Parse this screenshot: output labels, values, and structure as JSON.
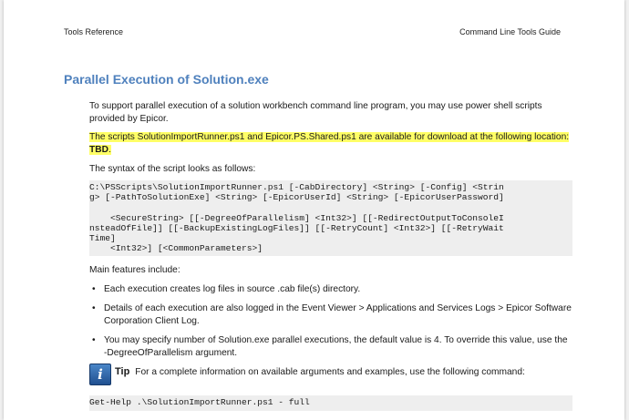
{
  "header": {
    "left": "Tools Reference",
    "right": "Command Line Tools Guide"
  },
  "section": {
    "title": "Parallel Execution of Solution.exe"
  },
  "content": {
    "intro": "To support parallel execution of a solution workbench command line program, you may use power shell scripts provided by Epicor.",
    "highlight_text": "The scripts SolutionImportRunner.ps1 and Epicor.PS.Shared.ps1 are available for download at the following location: ",
    "highlight_bold": "TBD",
    "highlight_end": ".",
    "syntax_intro": "The syntax of the script looks as follows:",
    "syntax_code": "C:\\PSScripts\\SolutionImportRunner.ps1 [-CabDirectory] <String> [-Config] <Strin\ng> [-PathToSolutionExe] <String> [-EpicorUserId] <String> [-EpicorUserPassword]\n\n    <SecureString> [[-DegreeOfParallelism] <Int32>] [[-RedirectOutputToConsoleI\nnsteadOfFile]] [[-BackupExistingLogFiles]] [[-RetryCount] <Int32>] [[-RetryWait\nTime]\n    <Int32>] [<CommonParameters>]",
    "features_intro": "Main features include:",
    "features": [
      "Each execution creates log files in source .cab file(s) directory.",
      "Details of each execution are also logged in the Event Viewer > Applications and Services Logs > Epicor Software Corporation Client Log.",
      "You may specify number of Solution.exe parallel executions, the default value is 4. To override this value, use the -DegreeOfParallelism argument."
    ],
    "bullet_glyph": "•",
    "tip": {
      "icon": "info-icon",
      "icon_glyph": "i",
      "label": "Tip",
      "text": "For a complete information on available arguments and examples, use the following command:"
    },
    "help_code": "Get-Help .\\SolutionImportRunner.ps1 - full"
  },
  "colors": {
    "title": "#4f81bd",
    "highlight": "#ffff66",
    "code_bg": "#eeeeee"
  }
}
